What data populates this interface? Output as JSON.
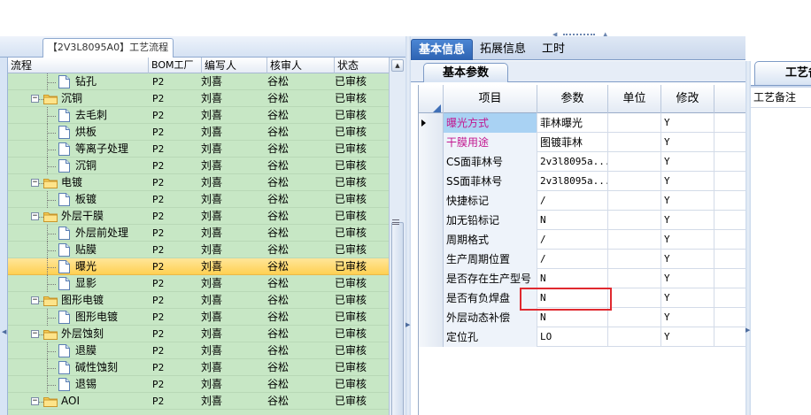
{
  "left_panel": {
    "tab_title": "【2V3L8095A0】工艺流程",
    "columns": [
      "流程",
      "BOM工厂",
      "编写人",
      "核审人",
      "状态"
    ],
    "rows": [
      {
        "name": "钻孔",
        "factory": "P2",
        "writer": "刘喜",
        "reviewer": "谷松",
        "status": "已审核"
      },
      {
        "name": "沉铜",
        "factory": "P2",
        "writer": "刘喜",
        "reviewer": "谷松",
        "status": "已审核"
      },
      {
        "name": "去毛刺",
        "factory": "P2",
        "writer": "刘喜",
        "reviewer": "谷松",
        "status": "已审核"
      },
      {
        "name": "烘板",
        "factory": "P2",
        "writer": "刘喜",
        "reviewer": "谷松",
        "status": "已审核"
      },
      {
        "name": "等离子处理",
        "factory": "P2",
        "writer": "刘喜",
        "reviewer": "谷松",
        "status": "已审核"
      },
      {
        "name": "沉铜",
        "factory": "P2",
        "writer": "刘喜",
        "reviewer": "谷松",
        "status": "已审核"
      },
      {
        "name": "电镀",
        "factory": "P2",
        "writer": "刘喜",
        "reviewer": "谷松",
        "status": "已审核"
      },
      {
        "name": "板镀",
        "factory": "P2",
        "writer": "刘喜",
        "reviewer": "谷松",
        "status": "已审核"
      },
      {
        "name": "外层干膜",
        "factory": "P2",
        "writer": "刘喜",
        "reviewer": "谷松",
        "status": "已审核"
      },
      {
        "name": "外层前处理",
        "factory": "P2",
        "writer": "刘喜",
        "reviewer": "谷松",
        "status": "已审核"
      },
      {
        "name": "贴膜",
        "factory": "P2",
        "writer": "刘喜",
        "reviewer": "谷松",
        "status": "已审核"
      },
      {
        "name": "曝光",
        "factory": "P2",
        "writer": "刘喜",
        "reviewer": "谷松",
        "status": "已审核"
      },
      {
        "name": "显影",
        "factory": "P2",
        "writer": "刘喜",
        "reviewer": "谷松",
        "status": "已审核"
      },
      {
        "name": "图形电镀",
        "factory": "P2",
        "writer": "刘喜",
        "reviewer": "谷松",
        "status": "已审核"
      },
      {
        "name": "图形电镀",
        "factory": "P2",
        "writer": "刘喜",
        "reviewer": "谷松",
        "status": "已审核"
      },
      {
        "name": "外层蚀刻",
        "factory": "P2",
        "writer": "刘喜",
        "reviewer": "谷松",
        "status": "已审核"
      },
      {
        "name": "退膜",
        "factory": "P2",
        "writer": "刘喜",
        "reviewer": "谷松",
        "status": "已审核"
      },
      {
        "name": "碱性蚀刻",
        "factory": "P2",
        "writer": "刘喜",
        "reviewer": "谷松",
        "status": "已审核"
      },
      {
        "name": "退锡",
        "factory": "P2",
        "writer": "刘喜",
        "reviewer": "谷松",
        "status": "已审核"
      },
      {
        "name": "AOI",
        "factory": "P2",
        "writer": "刘喜",
        "reviewer": "谷松",
        "status": "已审核"
      }
    ]
  },
  "middle_panel": {
    "tabs": [
      "基本信息",
      "拓展信息",
      "工时"
    ],
    "sub_tab": "基本参数",
    "columns": [
      "项目",
      "参数",
      "单位",
      "修改"
    ],
    "rows": [
      {
        "item": "曝光方式",
        "param": "菲林曝光",
        "unit": "",
        "modify": "Y"
      },
      {
        "item": "干膜用途",
        "param": "图镀菲林",
        "unit": "",
        "modify": "Y"
      },
      {
        "item": "CS面菲林号",
        "param": "2v3l8095a...",
        "unit": "",
        "modify": "Y"
      },
      {
        "item": "SS面菲林号",
        "param": "2v3l8095a...",
        "unit": "",
        "modify": "Y"
      },
      {
        "item": "快捷标记",
        "param": "/",
        "unit": "",
        "modify": "Y"
      },
      {
        "item": "加无铅标记",
        "param": "N",
        "unit": "",
        "modify": "Y"
      },
      {
        "item": "周期格式",
        "param": "/",
        "unit": "",
        "modify": "Y"
      },
      {
        "item": "生产周期位置",
        "param": "/",
        "unit": "",
        "modify": "Y"
      },
      {
        "item": "是否存在生产型号",
        "param": "N",
        "unit": "",
        "modify": "Y"
      },
      {
        "item": "是否有负焊盘",
        "param": "N",
        "unit": "",
        "modify": "Y"
      },
      {
        "item": "外层动态补偿",
        "param": "N",
        "unit": "",
        "modify": "Y"
      },
      {
        "item": "定位孔",
        "param": "LO",
        "unit": "",
        "modify": "Y"
      }
    ]
  },
  "right_panel": {
    "tab_title": "工艺备",
    "label": "工艺备注"
  },
  "colors": {
    "tree_bg": "#c7e7c5",
    "selected_row": "#ffd052",
    "active_tab": "#2d63b2",
    "highlight_text": "#c21890",
    "annotation_box": "#e0292f"
  }
}
